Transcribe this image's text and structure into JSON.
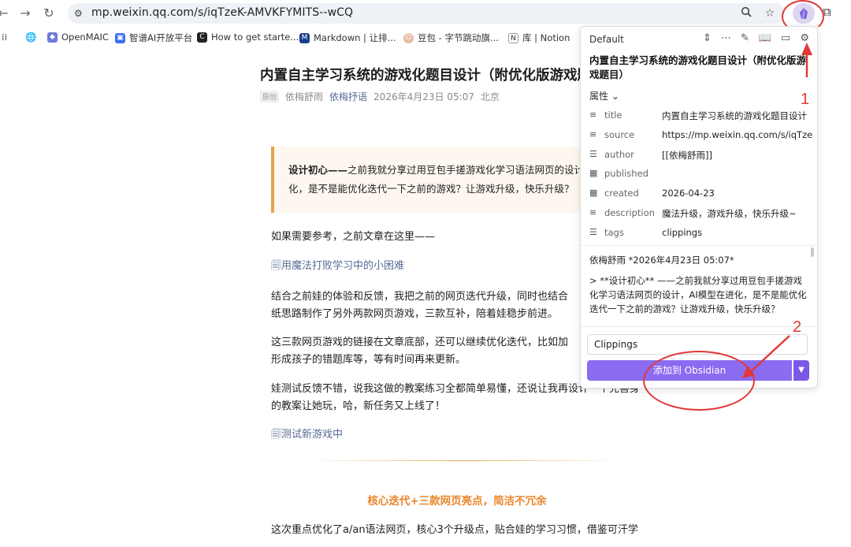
{
  "browser": {
    "url": "mp.weixin.qq.com/s/iqTzeK-AMVKFYMITS--wCQ",
    "bookmarks": [
      {
        "label": "OpenMAIC"
      },
      {
        "label": "智谱AI开放平台"
      },
      {
        "label": "How to get starte..."
      },
      {
        "label": "Markdown | 让排..."
      },
      {
        "label": "豆包 - 字节跳动旗..."
      },
      {
        "label": "库 | Notion"
      }
    ]
  },
  "article": {
    "title": "内置自主学习系统的游戏化题目设计（附优化版游戏题",
    "badge": "原创",
    "author": "依梅舒雨",
    "account": "依梅抒语",
    "date": "2026年4月23日 05:07",
    "location": "北京",
    "quote_bold": "设计初心——",
    "quote_line1": "之前我就分享过用豆包手搓游戏化学习语法网页的设计，",
    "quote_line2": "化，是不是能优化迭代一下之前的游戏？让游戏升级，快乐升级？",
    "p1": "如果需要参考，之前文章在这里——",
    "link1": "用魔法打败学习中的小困难",
    "p2_line1": "结合之前娃的体验和反馈，我把之前的网页迭代升级，同时也结合",
    "p2_line2": "纸思路制作了另外两款网页游戏，三款互补，陪着娃稳步前进。",
    "p3_line1": "这三款网页游戏的链接在文章底部，还可以继续优化迭代，比如加",
    "p3_line2": "形成孩子的错题库等，等有时间再来更新。",
    "p4_line1": "娃测试反馈不错，说我这做的教案练习全都简单易懂，还说让我再设计一个完善身",
    "p4_line2": "的教案让她玩，哈，新任务又上线了！",
    "link2": "测试新游戏中",
    "section_title": "核心迭代+三款网页亮点，简洁不冗余",
    "p5": "这次重点优化了a/an语法网页，核心3个升级点，贴合娃的学习习惯，借鉴可汗学"
  },
  "clipper": {
    "template": "Default",
    "title": "内置自主学习系统的游戏化题目设计（附优化版游戏题目）",
    "properties_label": "属性",
    "properties": [
      {
        "key": "title",
        "value": "内置自主学习系统的游戏化题目设计",
        "icon": "text-lines-icon"
      },
      {
        "key": "source",
        "value": "https://mp.weixin.qq.com/s/iqTzeK-AI",
        "icon": "text-lines-icon"
      },
      {
        "key": "author",
        "value": "[[依梅舒雨]]",
        "icon": "list-icon"
      },
      {
        "key": "published",
        "value": "",
        "icon": "calendar-icon"
      },
      {
        "key": "created",
        "value": "2026-04-23",
        "icon": "calendar-icon"
      },
      {
        "key": "description",
        "value": "魔法升级，游戏升级，快乐升级~",
        "icon": "text-lines-icon"
      },
      {
        "key": "tags",
        "value": "clippings",
        "icon": "list-icon"
      }
    ],
    "content_line1": "依梅舒雨 *2026年4月23日 05:07*",
    "content_line2": "> **设计初心** ——之前我就分享过用豆包手搓游戏化学习语法网页的设计，AI模型在进化，是不是能优化迭代一下之前的游戏？让游戏升级，快乐升级？",
    "folder": "Clippings",
    "add_button": "添加到 Obsidian"
  },
  "annotations": {
    "label1": "1",
    "label2": "2",
    "color": "#e23838"
  }
}
